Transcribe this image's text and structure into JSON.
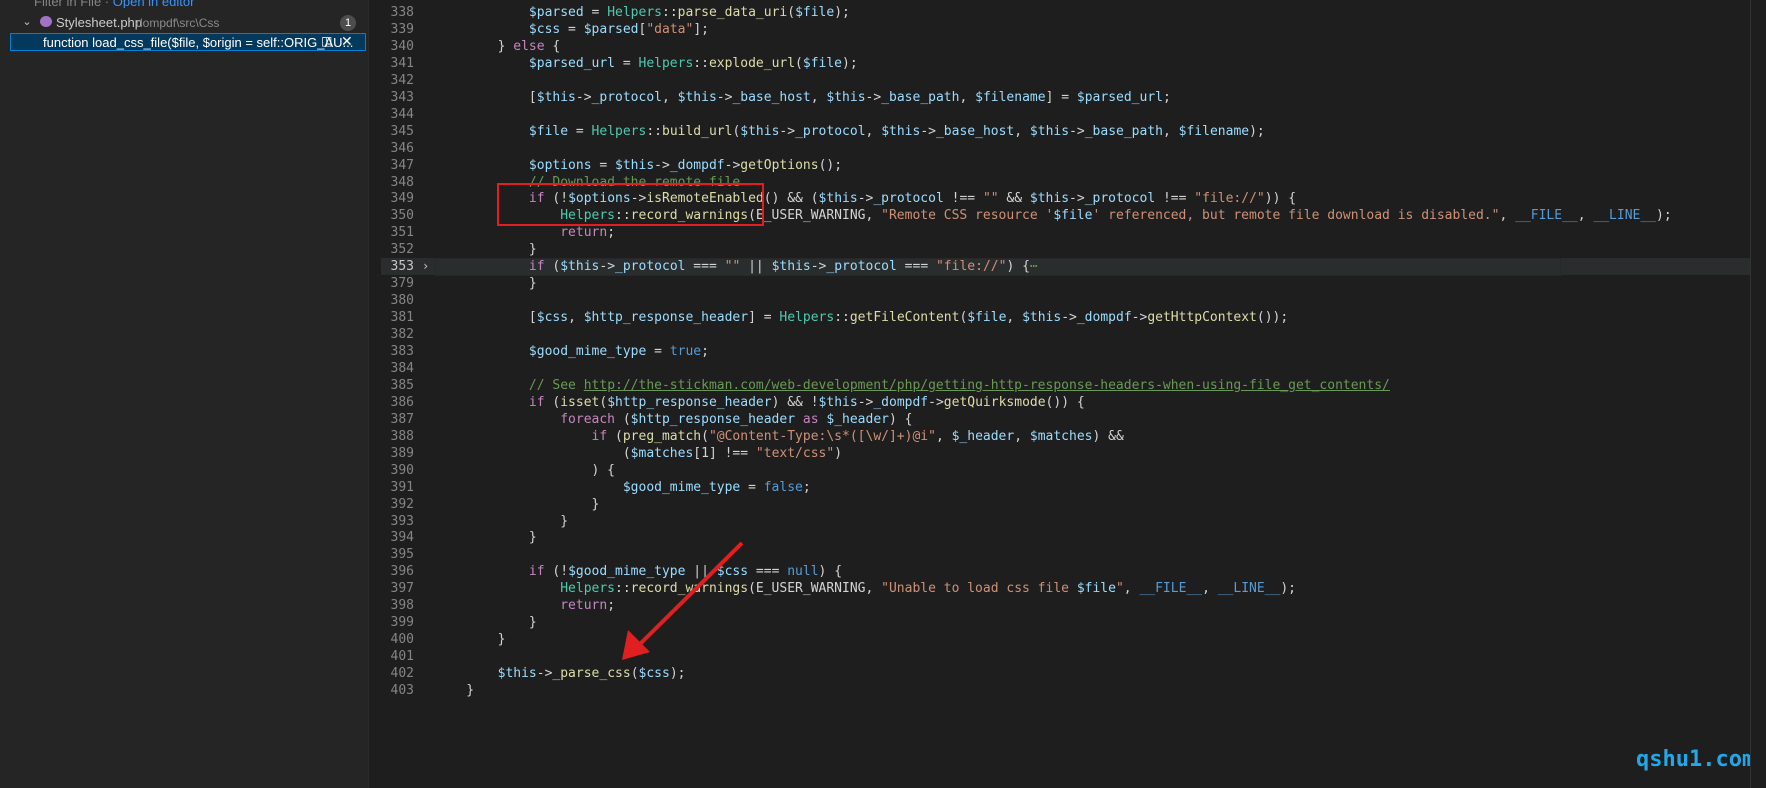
{
  "sidebar": {
    "header_text": "Filter in File",
    "header_link": "Open in editor",
    "file": {
      "name": "Stylesheet.php",
      "path": "dompdf\\src\\Css",
      "count": "1"
    },
    "match": {
      "text": "function load_css_file($file, $origin = self::ORIG_AU..."
    }
  },
  "editor": {
    "current_line": "353",
    "lines": [
      {
        "n": "338",
        "code": [
          [
            "v",
            "            $parsed"
          ],
          [
            "p",
            " = "
          ],
          [
            "t",
            "Helpers"
          ],
          [
            "p",
            "::"
          ],
          [
            "f",
            "parse_data_uri"
          ],
          [
            "p",
            "("
          ],
          [
            "v",
            "$file"
          ],
          [
            "p",
            ");"
          ]
        ]
      },
      {
        "n": "339",
        "code": [
          [
            "v",
            "            $css"
          ],
          [
            "p",
            " = "
          ],
          [
            "v",
            "$parsed"
          ],
          [
            "p",
            "["
          ],
          [
            "s",
            "\"data\""
          ],
          [
            "p",
            "];"
          ]
        ]
      },
      {
        "n": "340",
        "code": [
          [
            "p",
            "        } "
          ],
          [
            "k",
            "else"
          ],
          [
            "p",
            " {"
          ]
        ]
      },
      {
        "n": "341",
        "code": [
          [
            "v",
            "            $parsed_url"
          ],
          [
            "p",
            " = "
          ],
          [
            "t",
            "Helpers"
          ],
          [
            "p",
            "::"
          ],
          [
            "f",
            "explode_url"
          ],
          [
            "p",
            "("
          ],
          [
            "v",
            "$file"
          ],
          [
            "p",
            ");"
          ]
        ]
      },
      {
        "n": "342",
        "code": []
      },
      {
        "n": "343",
        "code": [
          [
            "p",
            "            ["
          ],
          [
            "v",
            "$this"
          ],
          [
            "p",
            "->"
          ],
          [
            "v",
            "_protocol"
          ],
          [
            "p",
            ", "
          ],
          [
            "v",
            "$this"
          ],
          [
            "p",
            "->"
          ],
          [
            "v",
            "_base_host"
          ],
          [
            "p",
            ", "
          ],
          [
            "v",
            "$this"
          ],
          [
            "p",
            "->"
          ],
          [
            "v",
            "_base_path"
          ],
          [
            "p",
            ", "
          ],
          [
            "v",
            "$filename"
          ],
          [
            "p",
            "] = "
          ],
          [
            "v",
            "$parsed_url"
          ],
          [
            "p",
            ";"
          ]
        ]
      },
      {
        "n": "344",
        "code": []
      },
      {
        "n": "345",
        "code": [
          [
            "v",
            "            $file"
          ],
          [
            "p",
            " = "
          ],
          [
            "t",
            "Helpers"
          ],
          [
            "p",
            "::"
          ],
          [
            "f",
            "build_url"
          ],
          [
            "p",
            "("
          ],
          [
            "v",
            "$this"
          ],
          [
            "p",
            "->"
          ],
          [
            "v",
            "_protocol"
          ],
          [
            "p",
            ", "
          ],
          [
            "v",
            "$this"
          ],
          [
            "p",
            "->"
          ],
          [
            "v",
            "_base_host"
          ],
          [
            "p",
            ", "
          ],
          [
            "v",
            "$this"
          ],
          [
            "p",
            "->"
          ],
          [
            "v",
            "_base_path"
          ],
          [
            "p",
            ", "
          ],
          [
            "v",
            "$filename"
          ],
          [
            "p",
            ");"
          ]
        ]
      },
      {
        "n": "346",
        "code": []
      },
      {
        "n": "347",
        "code": [
          [
            "v",
            "            $options"
          ],
          [
            "p",
            " = "
          ],
          [
            "v",
            "$this"
          ],
          [
            "p",
            "->"
          ],
          [
            "v",
            "_dompdf"
          ],
          [
            "p",
            "->"
          ],
          [
            "f",
            "getOptions"
          ],
          [
            "p",
            "();"
          ]
        ]
      },
      {
        "n": "348",
        "code": [
          [
            "c",
            "            // Download the remote file"
          ]
        ]
      },
      {
        "n": "349",
        "code": [
          [
            "k",
            "            if"
          ],
          [
            "p",
            " (!"
          ],
          [
            "v",
            "$options"
          ],
          [
            "p",
            "->"
          ],
          [
            "f",
            "isRemoteEnabled"
          ],
          [
            "p",
            "() && ("
          ],
          [
            "v",
            "$this"
          ],
          [
            "p",
            "->"
          ],
          [
            "v",
            "_protocol"
          ],
          [
            "p",
            " !== "
          ],
          [
            "s",
            "\"\""
          ],
          [
            "p",
            " && "
          ],
          [
            "v",
            "$this"
          ],
          [
            "p",
            "->"
          ],
          [
            "v",
            "_protocol"
          ],
          [
            "p",
            " !== "
          ],
          [
            "s",
            "\"file://\""
          ],
          [
            "p",
            ")) {"
          ]
        ]
      },
      {
        "n": "350",
        "code": [
          [
            "t",
            "                Helpers"
          ],
          [
            "p",
            "::"
          ],
          [
            "f",
            "record_warnings"
          ],
          [
            "p",
            "(E_USER_WARNING, "
          ],
          [
            "s",
            "\"Remote CSS resource '"
          ],
          [
            "v",
            "$file"
          ],
          [
            "s",
            "' referenced, but remote file download is disabled.\""
          ],
          [
            "p",
            ", "
          ],
          [
            "b",
            "__FILE__"
          ],
          [
            "p",
            ", "
          ],
          [
            "b",
            "__LINE__"
          ],
          [
            "p",
            ");"
          ]
        ]
      },
      {
        "n": "351",
        "code": [
          [
            "k",
            "                return"
          ],
          [
            "p",
            ";"
          ]
        ]
      },
      {
        "n": "352",
        "code": [
          [
            "p",
            "            }"
          ]
        ]
      },
      {
        "n": "353",
        "code": [
          [
            "k",
            "            if"
          ],
          [
            "p",
            " ("
          ],
          [
            "v",
            "$this"
          ],
          [
            "p",
            "->"
          ],
          [
            "v",
            "_protocol"
          ],
          [
            "p",
            " === "
          ],
          [
            "s",
            "\"\""
          ],
          [
            "p",
            " || "
          ],
          [
            "v",
            "$this"
          ],
          [
            "p",
            "->"
          ],
          [
            "v",
            "_protocol"
          ],
          [
            "p",
            " === "
          ],
          [
            "s",
            "\"file://\""
          ],
          [
            "p",
            ") {"
          ],
          [
            "c",
            "⋯"
          ]
        ]
      },
      {
        "n": "379",
        "code": [
          [
            "p",
            "            }"
          ]
        ]
      },
      {
        "n": "380",
        "code": []
      },
      {
        "n": "381",
        "code": [
          [
            "p",
            "            ["
          ],
          [
            "v",
            "$css"
          ],
          [
            "p",
            ", "
          ],
          [
            "v",
            "$http_response_header"
          ],
          [
            "p",
            "] = "
          ],
          [
            "t",
            "Helpers"
          ],
          [
            "p",
            "::"
          ],
          [
            "f",
            "getFileContent"
          ],
          [
            "p",
            "("
          ],
          [
            "v",
            "$file"
          ],
          [
            "p",
            ", "
          ],
          [
            "v",
            "$this"
          ],
          [
            "p",
            "->"
          ],
          [
            "v",
            "_dompdf"
          ],
          [
            "p",
            "->"
          ],
          [
            "f",
            "getHttpContext"
          ],
          [
            "p",
            "());"
          ]
        ]
      },
      {
        "n": "382",
        "code": []
      },
      {
        "n": "383",
        "code": [
          [
            "v",
            "            $good_mime_type"
          ],
          [
            "p",
            " = "
          ],
          [
            "kw",
            "true"
          ],
          [
            "p",
            ";"
          ]
        ]
      },
      {
        "n": "384",
        "code": []
      },
      {
        "n": "385",
        "code": [
          [
            "c",
            "            // See "
          ],
          [
            "u",
            "http://the-stickman.com/web-development/php/getting-http-response-headers-when-using-file_get_contents/"
          ]
        ]
      },
      {
        "n": "386",
        "code": [
          [
            "k",
            "            if"
          ],
          [
            "p",
            " ("
          ],
          [
            "f",
            "isset"
          ],
          [
            "p",
            "("
          ],
          [
            "v",
            "$http_response_header"
          ],
          [
            "p",
            ") && !"
          ],
          [
            "v",
            "$this"
          ],
          [
            "p",
            "->"
          ],
          [
            "v",
            "_dompdf"
          ],
          [
            "p",
            "->"
          ],
          [
            "f",
            "getQuirksmode"
          ],
          [
            "p",
            "()) {"
          ]
        ]
      },
      {
        "n": "387",
        "code": [
          [
            "k",
            "                foreach"
          ],
          [
            "p",
            " ("
          ],
          [
            "v",
            "$http_response_header"
          ],
          [
            "k",
            " as "
          ],
          [
            "v",
            "$_header"
          ],
          [
            "p",
            ") {"
          ]
        ]
      },
      {
        "n": "388",
        "code": [
          [
            "k",
            "                    if"
          ],
          [
            "p",
            " ("
          ],
          [
            "f",
            "preg_match"
          ],
          [
            "p",
            "("
          ],
          [
            "s",
            "\"@Content-Type:\\s*([\\w/]+)@i\""
          ],
          [
            "p",
            ", "
          ],
          [
            "v",
            "$_header"
          ],
          [
            "p",
            ", "
          ],
          [
            "v",
            "$matches"
          ],
          [
            "p",
            ") &&"
          ]
        ]
      },
      {
        "n": "389",
        "code": [
          [
            "p",
            "                        ("
          ],
          [
            "v",
            "$matches"
          ],
          [
            "p",
            "[1] !== "
          ],
          [
            "s",
            "\"text/css\""
          ],
          [
            "p",
            ")"
          ]
        ]
      },
      {
        "n": "390",
        "code": [
          [
            "p",
            "                    ) {"
          ]
        ]
      },
      {
        "n": "391",
        "code": [
          [
            "v",
            "                        $good_mime_type"
          ],
          [
            "p",
            " = "
          ],
          [
            "kw",
            "false"
          ],
          [
            "p",
            ";"
          ]
        ]
      },
      {
        "n": "392",
        "code": [
          [
            "p",
            "                    }"
          ]
        ]
      },
      {
        "n": "393",
        "code": [
          [
            "p",
            "                }"
          ]
        ]
      },
      {
        "n": "394",
        "code": [
          [
            "p",
            "            }"
          ]
        ]
      },
      {
        "n": "395",
        "code": []
      },
      {
        "n": "396",
        "code": [
          [
            "k",
            "            if"
          ],
          [
            "p",
            " (!"
          ],
          [
            "v",
            "$good_mime_type"
          ],
          [
            "p",
            " || "
          ],
          [
            "v",
            "$css"
          ],
          [
            "p",
            " === "
          ],
          [
            "kw",
            "null"
          ],
          [
            "p",
            ") {"
          ]
        ]
      },
      {
        "n": "397",
        "code": [
          [
            "t",
            "                Helpers"
          ],
          [
            "p",
            "::"
          ],
          [
            "f",
            "record_warnings"
          ],
          [
            "p",
            "(E_USER_WARNING, "
          ],
          [
            "s",
            "\"Unable to load css file "
          ],
          [
            "v",
            "$file"
          ],
          [
            "s",
            "\""
          ],
          [
            "p",
            ", "
          ],
          [
            "b",
            "__FILE__"
          ],
          [
            "p",
            ", "
          ],
          [
            "b",
            "__LINE__"
          ],
          [
            "p",
            ");"
          ]
        ]
      },
      {
        "n": "398",
        "code": [
          [
            "k",
            "                return"
          ],
          [
            "p",
            ";"
          ]
        ]
      },
      {
        "n": "399",
        "code": [
          [
            "p",
            "            }"
          ]
        ]
      },
      {
        "n": "400",
        "code": [
          [
            "p",
            "        }"
          ]
        ]
      },
      {
        "n": "401",
        "code": []
      },
      {
        "n": "402",
        "code": [
          [
            "v",
            "        $this"
          ],
          [
            "p",
            "->"
          ],
          [
            "f",
            "_parse_css"
          ],
          [
            "p",
            "("
          ],
          [
            "v",
            "$css"
          ],
          [
            "p",
            ");"
          ]
        ]
      },
      {
        "n": "403",
        "code": [
          [
            "p",
            "    }"
          ]
        ]
      }
    ]
  },
  "watermark": "qshu1.com"
}
